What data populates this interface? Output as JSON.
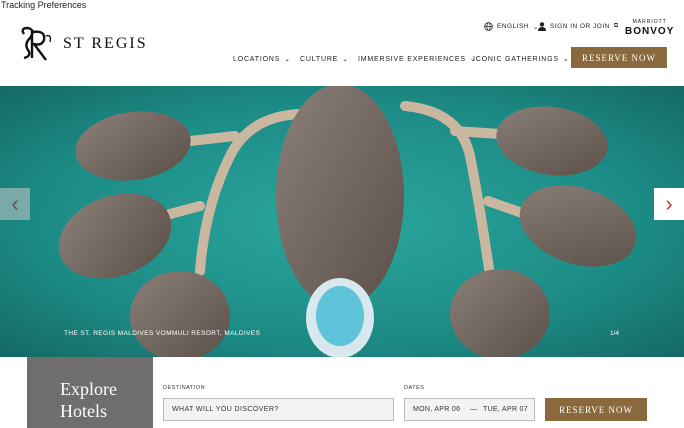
{
  "tracking_link": "Tracking Preferences",
  "brand": {
    "name": "ST REGIS",
    "monogram": "SR"
  },
  "utility": {
    "language": "ENGLISH",
    "sign_in": "SIGN IN OR JOIN"
  },
  "bonvoy": {
    "small": "MARRIOTT",
    "big": "BONVOY"
  },
  "nav": [
    {
      "label": "LOCATIONS"
    },
    {
      "label": "CULTURE"
    },
    {
      "label": "IMMERSIVE EXPERIENCES"
    },
    {
      "label": "ICONIC GATHERINGS"
    }
  ],
  "reserve_label": "RESERVE NOW",
  "hero": {
    "caption": "THE ST. REGIS MALDIVES VOMMULI RESORT, MALDIVES",
    "counter": "1/4",
    "prev_icon": "chevron-left-icon",
    "next_icon": "chevron-right-icon"
  },
  "booking": {
    "title_line1": "Explore",
    "title_line2": "Hotels",
    "destination_label": "DESTINATION",
    "destination_placeholder": "WHAT WILL YOU DISCOVER?",
    "dates_label": "DATES",
    "date_start": "MON, APR 06",
    "date_sep": "—",
    "date_end": "TUE, APR 07",
    "reserve_label": "RESERVE NOW"
  },
  "colors": {
    "accent": "#8a6a3c",
    "explore_bg": "#6f6e6c",
    "water": "#1f8c86"
  }
}
